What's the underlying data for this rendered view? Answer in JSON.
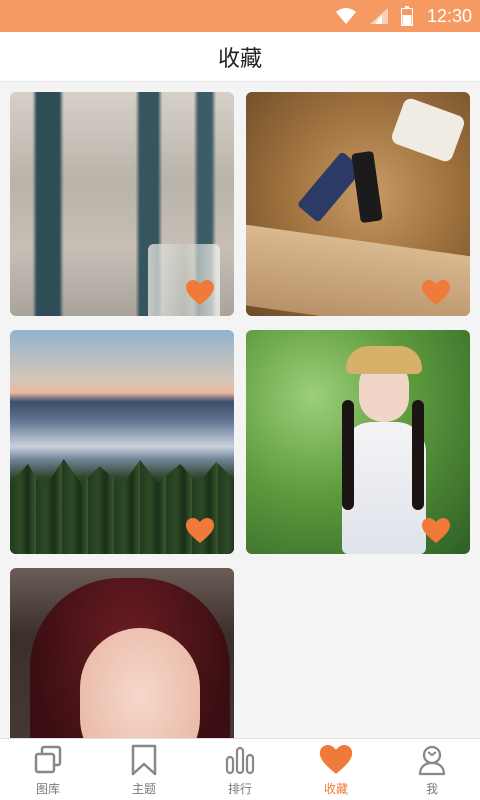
{
  "status_bar": {
    "time": "12:30",
    "icons": [
      "wifi-icon",
      "signal-icon",
      "battery-icon"
    ]
  },
  "header": {
    "title": "收藏"
  },
  "favorites": {
    "items": [
      {
        "subject": "window-and-glass-jar",
        "favorited": true
      },
      {
        "subject": "spools-of-thread-on-burlap",
        "favorited": true
      },
      {
        "subject": "sunrise-over-forest-and-fog",
        "favorited": true
      },
      {
        "subject": "girl-in-straw-hat-with-braids",
        "favorited": true
      },
      {
        "subject": "portrait-girl-red-hair",
        "favorited": false
      }
    ]
  },
  "tabbar": {
    "tabs": [
      {
        "label": "图库",
        "icon": "gallery-icon"
      },
      {
        "label": "主题",
        "icon": "bookmark-icon"
      },
      {
        "label": "排行",
        "icon": "ranking-icon"
      },
      {
        "label": "收藏",
        "icon": "heart-icon",
        "active": true
      },
      {
        "label": "我",
        "icon": "profile-icon"
      }
    ]
  },
  "colors": {
    "accent": "#f07a3a",
    "status_bar": "#f59a63",
    "tab_inactive": "#7a7a7a"
  }
}
